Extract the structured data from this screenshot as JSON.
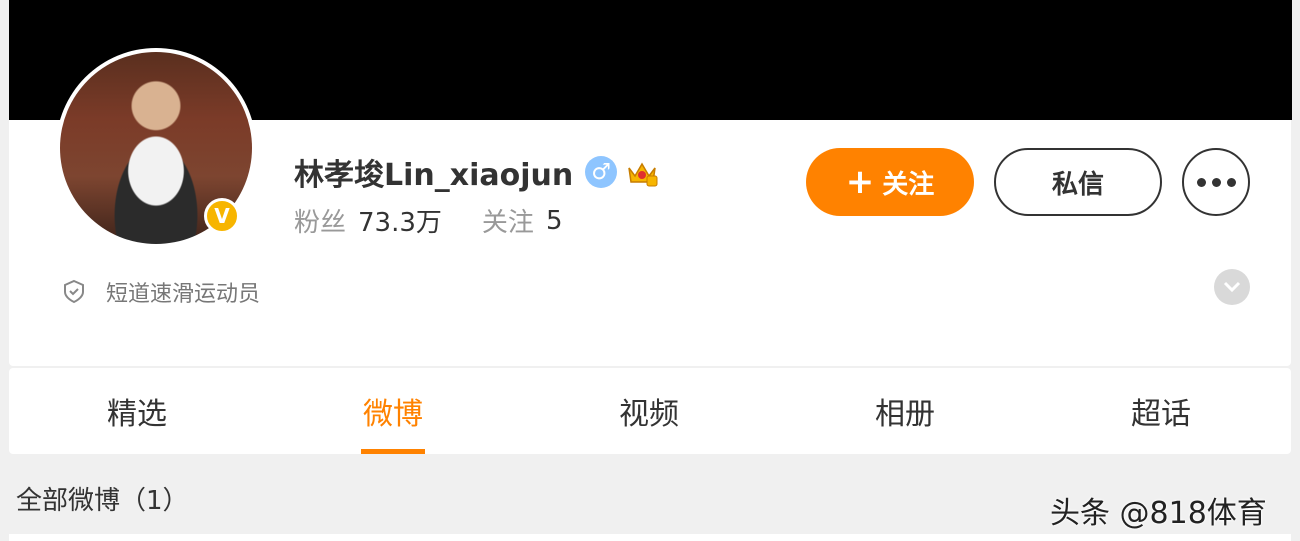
{
  "profile": {
    "name": "林孝埈Lin_xiaojun",
    "gender_symbol": "♂",
    "verified_badge": "V",
    "icons": [
      "gender-male-icon",
      "crown-icon",
      "verified-v-icon"
    ],
    "fans_label": "粉丝",
    "fans_value": "73.3万",
    "following_label": "关注",
    "following_value": "5",
    "description": "短道速滑运动员"
  },
  "actions": {
    "follow_plus": "+",
    "follow_label": "关注",
    "message_label": "私信"
  },
  "tabs": [
    {
      "label": "精选",
      "active": false
    },
    {
      "label": "微博",
      "active": true
    },
    {
      "label": "视频",
      "active": false
    },
    {
      "label": "相册",
      "active": false
    },
    {
      "label": "超话",
      "active": false
    }
  ],
  "feed": {
    "all_posts_label": "全部微博（1）"
  },
  "watermark": "头条 @818体育",
  "colors": {
    "accent": "#ff8200",
    "cover": "#000000",
    "verified": "#f7b500",
    "gender": "#8ec5ff"
  }
}
